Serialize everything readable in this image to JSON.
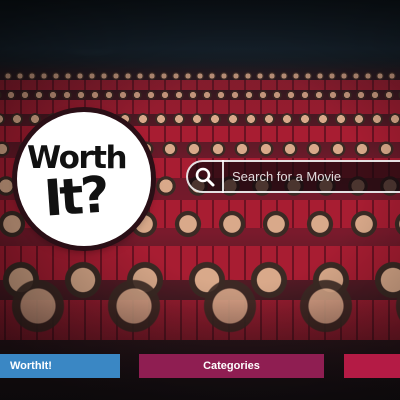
{
  "logo": {
    "line1": "Worth",
    "line2": "It?"
  },
  "search": {
    "placeholder": "Search for a Movie",
    "value": ""
  },
  "nav": {
    "items": [
      {
        "label": "WorthIt!",
        "color": "#3a87c4"
      },
      {
        "label": "Categories",
        "color": "#8f1e52"
      },
      {
        "label": "",
        "color": "#b41b45"
      }
    ]
  },
  "colors": {
    "seat_red": "#a81d32",
    "search_border": "#ffffff"
  }
}
